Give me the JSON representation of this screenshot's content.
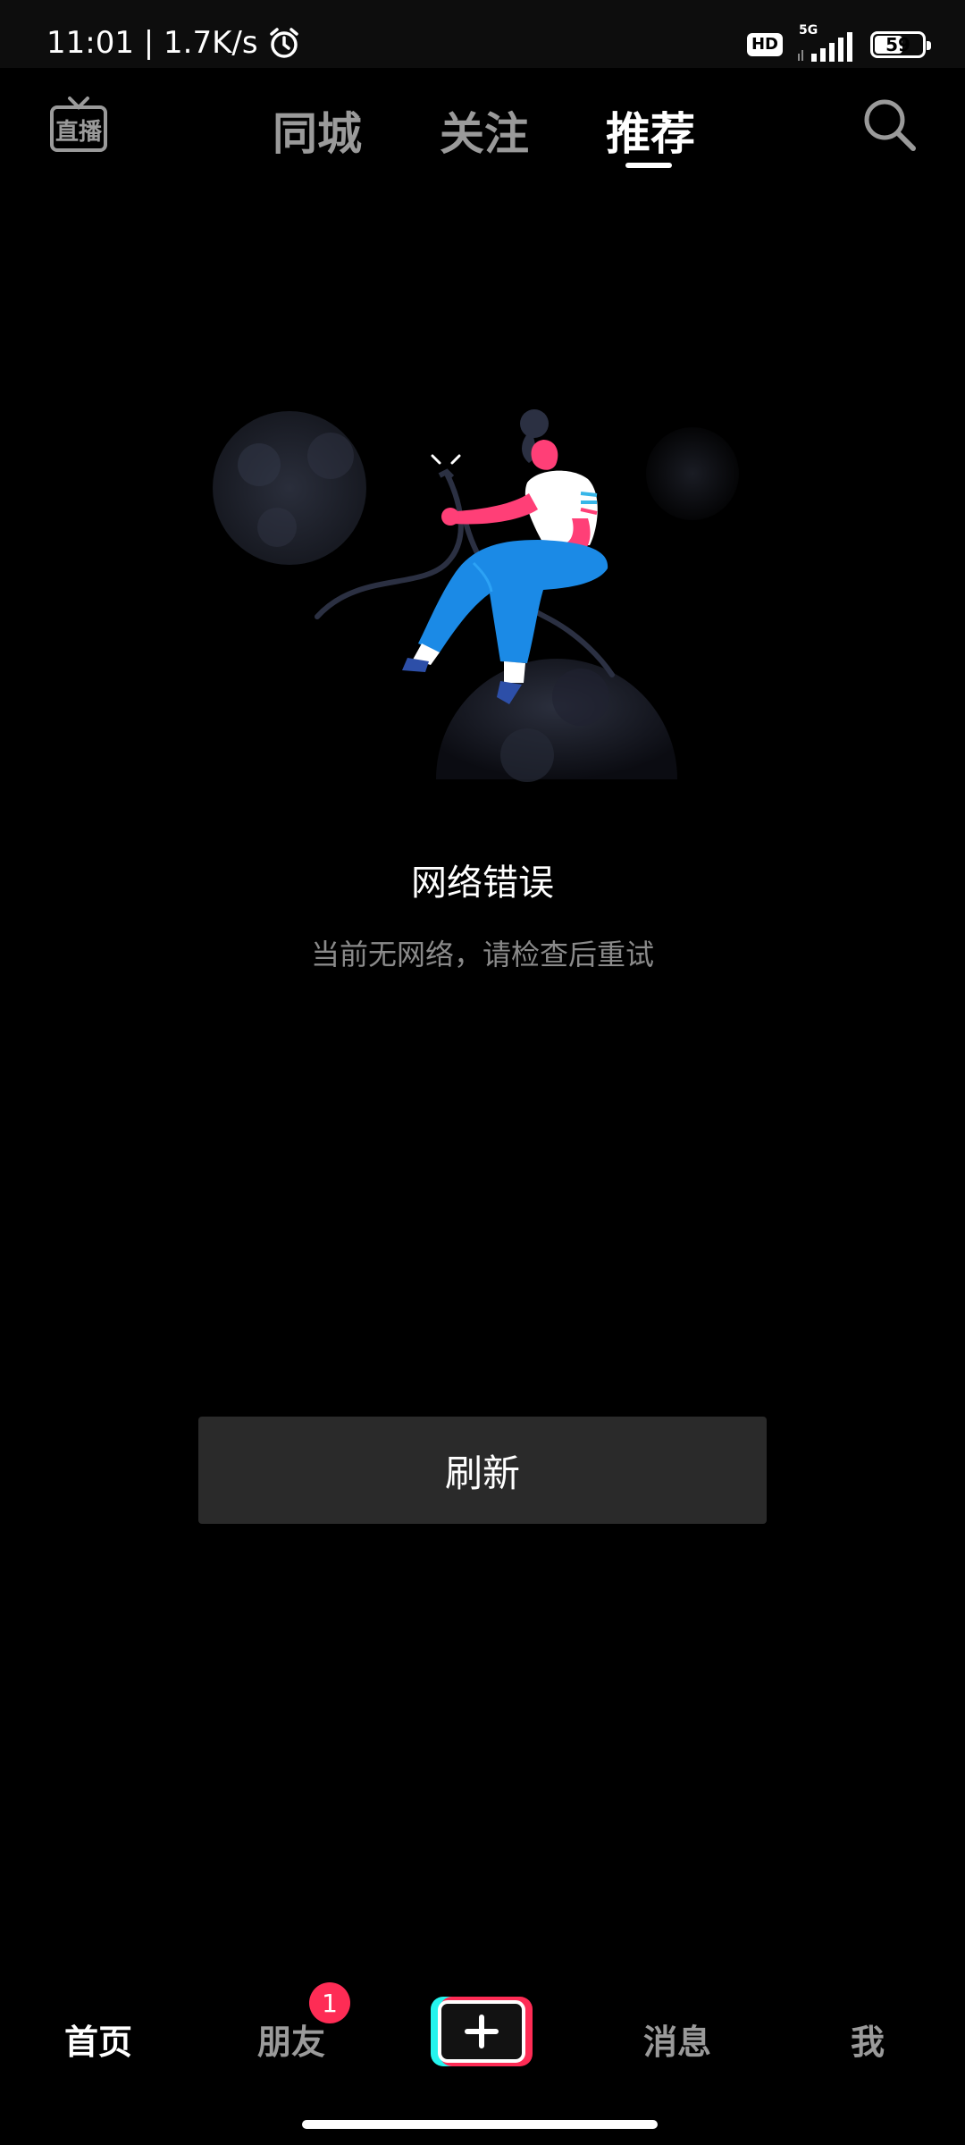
{
  "status_bar": {
    "time_speed": "11:01 | 1.7K/s",
    "hd": "HD",
    "network": "5G",
    "battery": "59",
    "battery_level": 0.59
  },
  "top_nav": {
    "live_label": "直播",
    "tabs": [
      {
        "label": "同城",
        "active": false
      },
      {
        "label": "关注",
        "active": false
      },
      {
        "label": "推荐",
        "active": true
      }
    ]
  },
  "error": {
    "title": "网络错误",
    "subtitle": "当前无网络，请检查后重试"
  },
  "refresh_label": "刷新",
  "bottom_nav": {
    "home": "首页",
    "friends": "朋友",
    "friends_badge": "1",
    "messages": "消息",
    "me": "我"
  },
  "colors": {
    "accent_red": "#fe2c55",
    "accent_cyan": "#25f4ee",
    "button_bg": "#2a2a2a"
  }
}
